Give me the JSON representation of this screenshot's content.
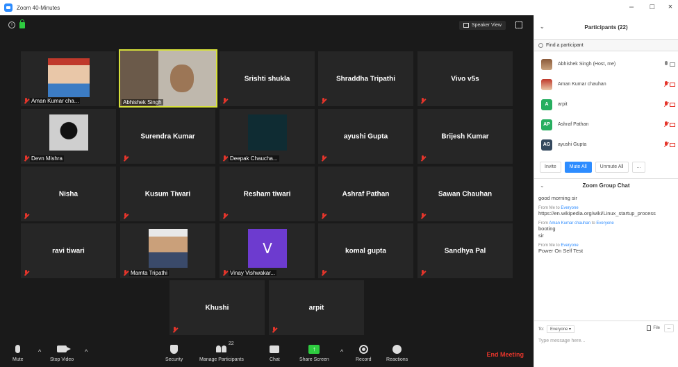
{
  "window": {
    "title": "Zoom 40-Minutes",
    "controls": [
      "–",
      "□",
      "×"
    ]
  },
  "video": {
    "speaker_view_label": "Speaker View",
    "tiles": [
      {
        "name": "Aman Kumar cha...",
        "label_only": true,
        "photo": "boy-in-turban"
      },
      {
        "name": "Abhishek Singh",
        "label_only": true,
        "photo": "man-webcam",
        "speaking": true
      },
      {
        "name": "Srishti shukla"
      },
      {
        "name": "Shraddha Tripathi"
      },
      {
        "name": "Vivo v5s"
      },
      {
        "name": "Devn Mishra",
        "label_only": true,
        "photo": "dark-figure"
      },
      {
        "name": "Surendra Kumar"
      },
      {
        "name": "Deepak Chaucha...",
        "label_only": true,
        "photo": "dark-teal"
      },
      {
        "name": "ayushi Gupta"
      },
      {
        "name": "Brijesh Kumar"
      },
      {
        "name": "Nisha"
      },
      {
        "name": "Kusum Tiwari"
      },
      {
        "name": "Resham tiwari"
      },
      {
        "name": "Ashraf Pathan"
      },
      {
        "name": "Sawan Chauhan"
      },
      {
        "name": "ravi tiwari"
      },
      {
        "name": "Mamta Tripathi",
        "label_only": true,
        "photo": "child"
      },
      {
        "name": "Vinay Vishwakar...",
        "label_only": true,
        "letter": "V"
      },
      {
        "name": "komal gupta"
      },
      {
        "name": "Sandhya Pal"
      },
      {
        "name": "Khushi"
      },
      {
        "name": "arpit"
      }
    ]
  },
  "toolbar": {
    "mute": "Mute",
    "stop_video": "Stop Video",
    "security": "Security",
    "manage_participants": "Manage Participants",
    "participant_count": "22",
    "chat": "Chat",
    "share_screen": "Share Screen",
    "record": "Record",
    "reactions": "Reactions",
    "end_meeting": "End Meeting"
  },
  "participants_panel": {
    "title": "Participants (22)",
    "search_placeholder": "Find a participant",
    "items": [
      {
        "name": "Abhishek Singh (Host, me)",
        "avatar": "photo",
        "muted": false
      },
      {
        "name": "Aman Kumar chauhan",
        "avatar": "photo",
        "muted": true
      },
      {
        "name": "arpit",
        "avatar": "A",
        "color": "#27ae60",
        "muted": true
      },
      {
        "name": "Ashraf Pathan",
        "avatar": "AP",
        "color": "#27ae60",
        "muted": true
      },
      {
        "name": "ayushi Gupta",
        "avatar": "AG",
        "color": "#34495e",
        "muted": true
      }
    ],
    "invite": "Invite",
    "mute_all": "Mute All",
    "unmute_all": "Unmute All",
    "more": "..."
  },
  "chat_panel": {
    "title": "Zoom Group Chat",
    "messages": [
      {
        "from": "",
        "text": "good morning sir"
      },
      {
        "from_prefix": "From Me to ",
        "from_target": "Everyone",
        "text": "https://en.wikipedia.org/wiki/Linux_startup_process"
      },
      {
        "from_prefix": "From ",
        "from_sender": "Aman Kumar chauhan",
        "from_mid": " to ",
        "from_target": "Everyone",
        "text": "booting"
      },
      {
        "from": "",
        "text": "sir"
      },
      {
        "from_prefix": "From Me to ",
        "from_target": "Everyone",
        "text": "Power On Self Test"
      }
    ],
    "to_label": "To:",
    "to_value": "Everyone ▾",
    "file": "File",
    "more": "...",
    "input_placeholder": "Type message here..."
  }
}
